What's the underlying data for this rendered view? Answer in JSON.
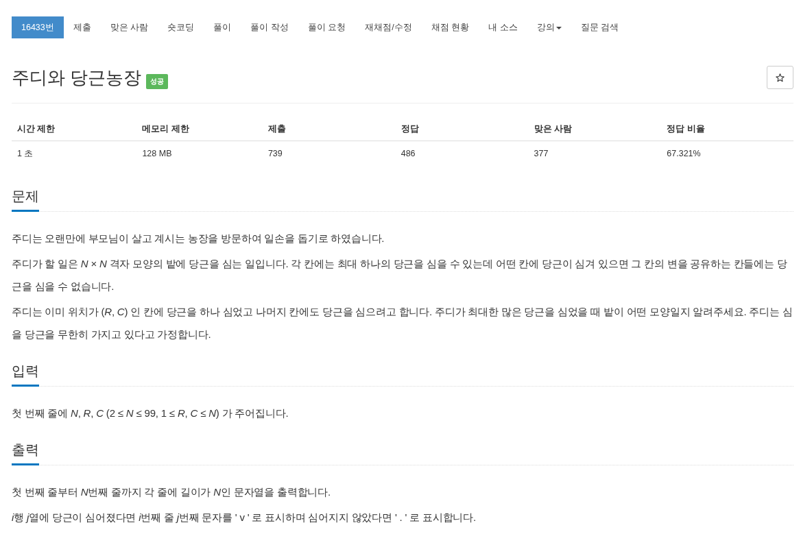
{
  "nav_tabs": [
    {
      "label": "16433번",
      "selected": true,
      "dropdown": false
    },
    {
      "label": "제출",
      "selected": false,
      "dropdown": false
    },
    {
      "label": "맞은 사람",
      "selected": false,
      "dropdown": false
    },
    {
      "label": "숏코딩",
      "selected": false,
      "dropdown": false
    },
    {
      "label": "풀이",
      "selected": false,
      "dropdown": false
    },
    {
      "label": "풀이 작성",
      "selected": false,
      "dropdown": false
    },
    {
      "label": "풀이 요청",
      "selected": false,
      "dropdown": false
    },
    {
      "label": "재채점/수정",
      "selected": false,
      "dropdown": false
    },
    {
      "label": "채점 현황",
      "selected": false,
      "dropdown": false
    },
    {
      "label": "내 소스",
      "selected": false,
      "dropdown": false
    },
    {
      "label": "강의",
      "selected": false,
      "dropdown": true
    },
    {
      "label": "질문 검색",
      "selected": false,
      "dropdown": false
    }
  ],
  "problem": {
    "title": "주디와 당근농장",
    "result_badge": "성공"
  },
  "stats_table": {
    "columns": [
      "시간 제한",
      "메모리 제한",
      "제출",
      "정답",
      "맞은 사람",
      "정답 비율"
    ],
    "rows": [
      [
        "1 초",
        "128 MB",
        "739",
        "486",
        "377",
        "67.321%"
      ]
    ]
  },
  "sections": [
    {
      "heading": "문제",
      "paragraphs": [
        "주디는 오랜만에 부모님이 살고 계시는 농장을 방문하여 일손을 돕기로 하였습니다.",
        "주디가 할 일은 *N* × *N* 격자 모양의 밭에 당근을 심는 일입니다. 각 칸에는 최대 하나의 당근을 심을 수 있는데 어떤 칸에 당근이 심겨 있으면 그 칸의 변을 공유하는 칸들에는 당근을 심을 수 없습니다.",
        "주디는 이미 위치가 (*R*, *C*) 인 칸에 당근을 하나 심었고 나머지 칸에도 당근을 심으려고 합니다. 주디가 최대한 많은 당근을 심었을 때 밭이 어떤 모양일지 알려주세요. 주디는 심을 당근을 무한히 가지고 있다고 가정합니다."
      ]
    },
    {
      "heading": "입력",
      "paragraphs": [
        "첫 번째 줄에 *N*, *R*, *C* (2 ≤ *N* ≤ 99, 1 ≤ *R*, *C* ≤ *N*) 가 주어집니다."
      ]
    },
    {
      "heading": "출력",
      "paragraphs": [
        {
          "runs": [
            {
              "text": "첫 번째 줄부터 ",
              "italic": false
            },
            {
              "text": "N",
              "italic": true
            },
            {
              "text": "번째 줄까지 각 줄에 길이가 ",
              "italic": false
            },
            {
              "text": "N",
              "italic": true
            },
            {
              "text": "인 문자열을 출력합니다.",
              "italic": false
            }
          ]
        },
        {
          "runs": [
            {
              "text": "i",
              "italic": true
            },
            {
              "text": "행 ",
              "italic": false
            },
            {
              "text": "j",
              "italic": true
            },
            {
              "text": "열에 당근이 심어졌다면 ",
              "italic": false
            },
            {
              "text": "i",
              "italic": true
            },
            {
              "text": "번째 줄 ",
              "italic": false
            },
            {
              "text": "j",
              "italic": true
            },
            {
              "text": "번째 문자를 ' v ' 로 표시하며 심어지지 않았다면 ' . ' 로 표시합니다.",
              "italic": false
            }
          ]
        }
      ]
    }
  ]
}
